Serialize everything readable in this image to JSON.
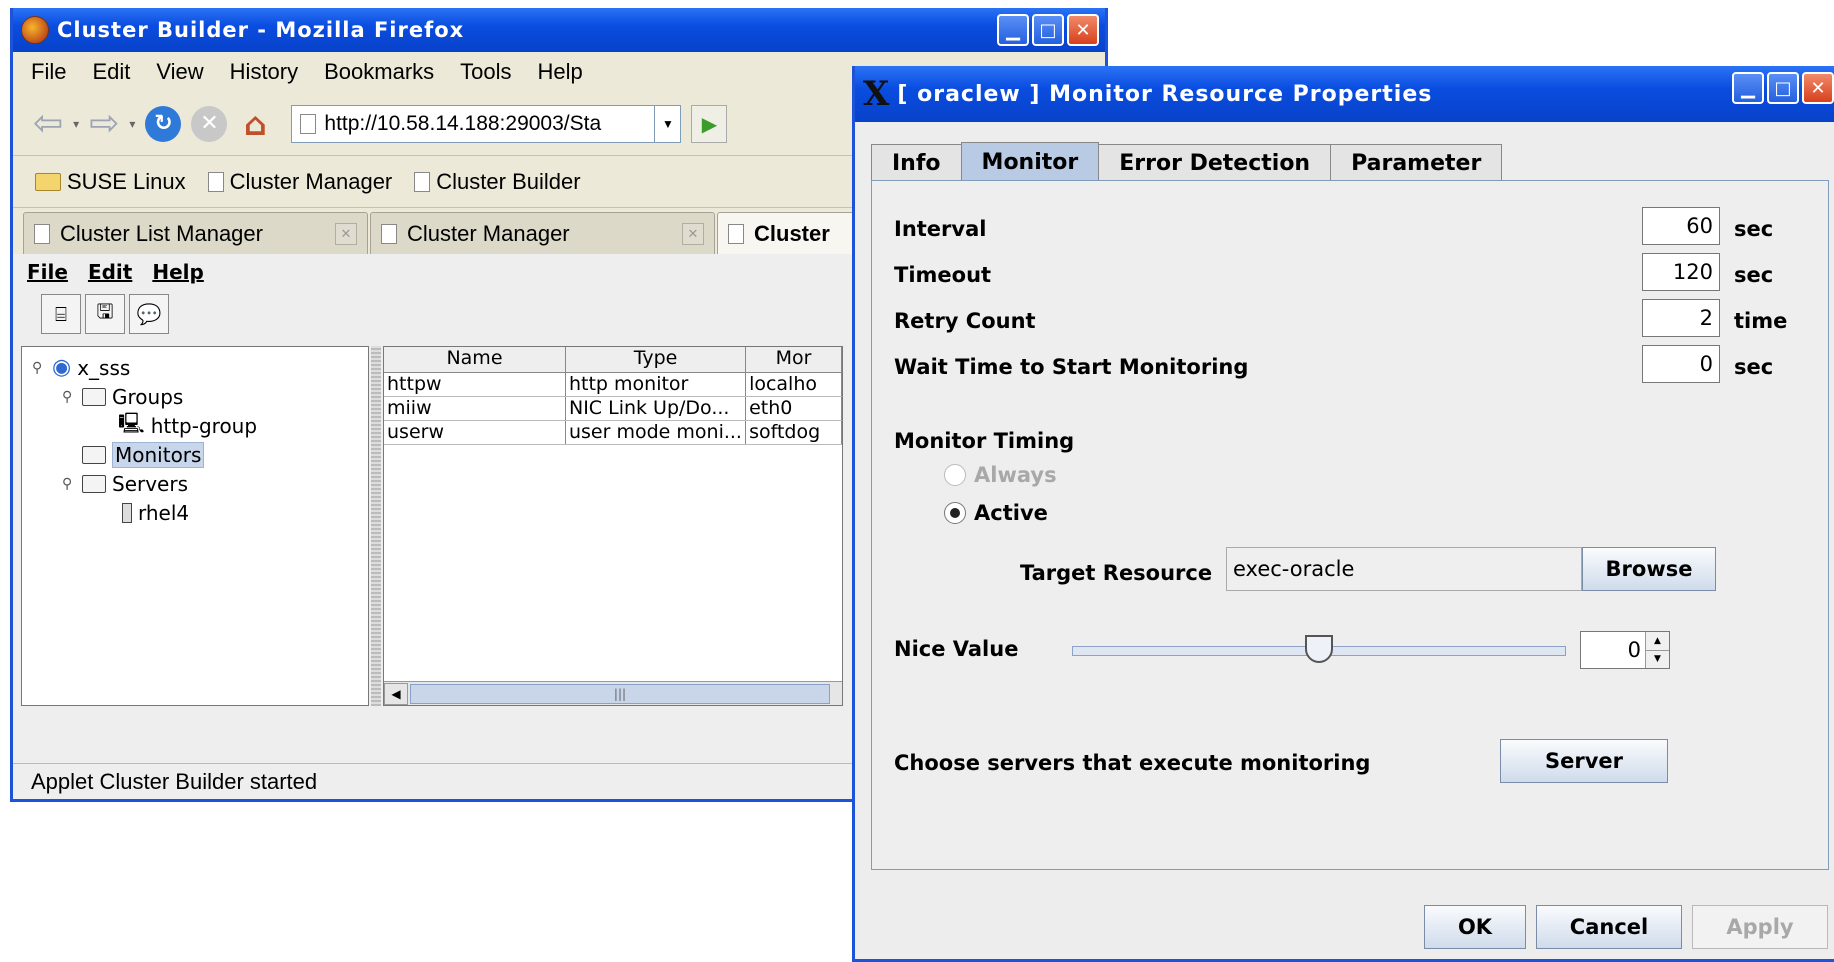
{
  "firefox": {
    "title": "Cluster Builder - Mozilla Firefox",
    "menu": [
      "File",
      "Edit",
      "View",
      "History",
      "Bookmarks",
      "Tools",
      "Help"
    ],
    "url": "http://10.58.14.188:29003/Sta",
    "bookmarks": [
      "SUSE Linux",
      "Cluster Manager",
      "Cluster Builder"
    ],
    "tabs": [
      "Cluster List Manager",
      "Cluster Manager",
      "Cluster"
    ],
    "status": "Applet Cluster Builder started"
  },
  "applet": {
    "menu": [
      "File",
      "Edit",
      "Help"
    ],
    "tree": {
      "root": "x_sss",
      "groups": "Groups",
      "group_item": "http-group",
      "monitors": "Monitors",
      "servers": "Servers",
      "server_item": "rhel4"
    },
    "table": {
      "headers": [
        "Name",
        "Type",
        "Mor"
      ],
      "rows": [
        [
          "httpw",
          "http monitor",
          "localho"
        ],
        [
          "miiw",
          "NIC Link Up/Do...",
          "eth0"
        ],
        [
          "userw",
          "user mode moni...",
          "softdog"
        ]
      ]
    }
  },
  "dialog": {
    "title": "[ oraclew ] Monitor Resource Properties",
    "tabs": [
      "Info",
      "Monitor",
      "Error Detection",
      "Parameter"
    ],
    "interval": {
      "label": "Interval",
      "value": "60",
      "unit": "sec"
    },
    "timeout": {
      "label": "Timeout",
      "value": "120",
      "unit": "sec"
    },
    "retry": {
      "label": "Retry Count",
      "value": "2",
      "unit": "time"
    },
    "wait": {
      "label": "Wait Time to Start Monitoring",
      "value": "0",
      "unit": "sec"
    },
    "timing": {
      "label": "Monitor Timing",
      "always": "Always",
      "active": "Active"
    },
    "target": {
      "label": "Target Resource",
      "value": "exec-oracle",
      "browse": "Browse"
    },
    "nice": {
      "label": "Nice Value",
      "value": "0",
      "slider_fraction": 0.5
    },
    "servers": {
      "label": "Choose servers that execute monitoring",
      "button": "Server"
    },
    "buttons": {
      "ok": "OK",
      "cancel": "Cancel",
      "apply": "Apply"
    }
  }
}
